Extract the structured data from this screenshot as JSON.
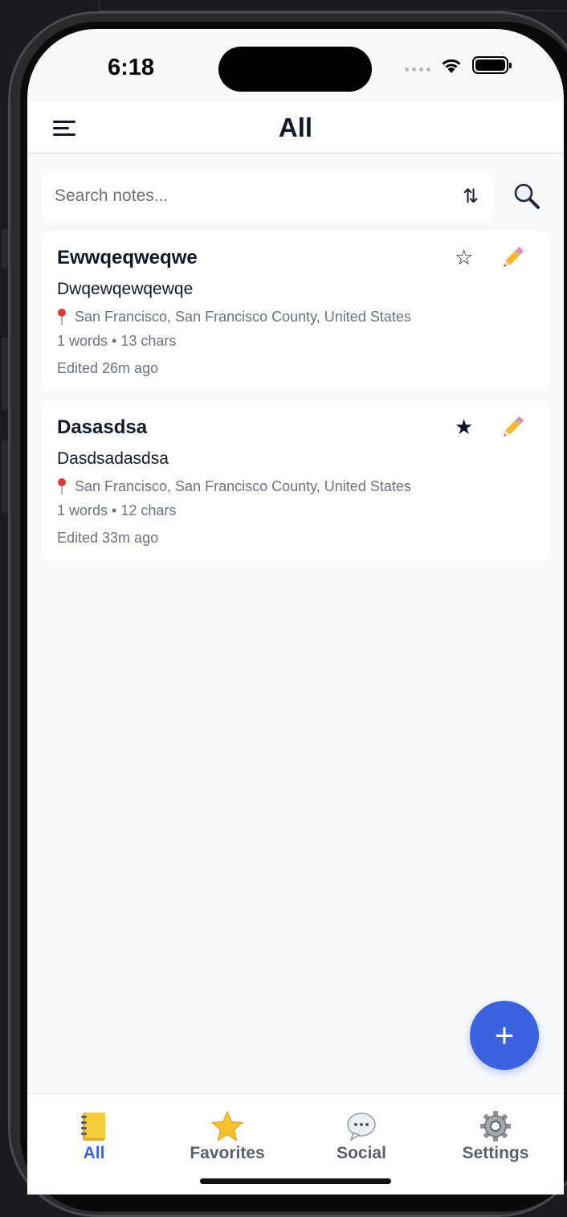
{
  "status_bar": {
    "time": "6:18"
  },
  "header": {
    "title": "All",
    "menu_icon": "hamburger-icon"
  },
  "search": {
    "placeholder": "Search notes...",
    "sort_icon": "sort-arrows-icon",
    "search_icon": "magnifier-icon"
  },
  "notes": [
    {
      "title": "Ewwqeqweqwe",
      "body": "Dwqewqewqewqe",
      "location": "San Francisco, San Francisco County, United States",
      "stats": "1 words • 13 chars",
      "edited": "Edited 26m ago",
      "favorite": false,
      "star_glyph": "☆"
    },
    {
      "title": "Dasasdsa",
      "body": "Dasdsadasdsa",
      "location": "San Francisco, San Francisco County, United States",
      "stats": "1 words • 12 chars",
      "edited": "Edited 33m ago",
      "favorite": true,
      "star_glyph": "★"
    }
  ],
  "fab": {
    "label": "+"
  },
  "tabs": [
    {
      "label": "All",
      "icon": "notebook-icon",
      "active": true
    },
    {
      "label": "Favorites",
      "icon": "star-icon",
      "active": false
    },
    {
      "label": "Social",
      "icon": "speech-bubble-icon",
      "active": false
    },
    {
      "label": "Settings",
      "icon": "gear-icon",
      "active": false
    }
  ],
  "colors": {
    "accent": "#3b63e0",
    "text": "#111827",
    "muted": "#6b7280",
    "background": "#f8f9fb"
  }
}
